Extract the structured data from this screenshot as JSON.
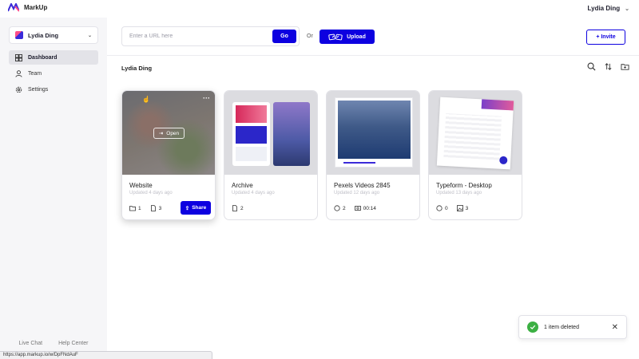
{
  "app": {
    "name": "MarkUp"
  },
  "header": {
    "user_name": "Lydia Ding"
  },
  "sidebar": {
    "workspace": "Lydia Ding",
    "items": [
      {
        "label": "Dashboard",
        "icon": "dashboard-icon",
        "active": true
      },
      {
        "label": "Team",
        "icon": "user-icon",
        "active": false
      },
      {
        "label": "Settings",
        "icon": "gear-icon",
        "active": false
      }
    ],
    "footer": {
      "live_chat": "Live Chat",
      "help_center": "Help Center"
    }
  },
  "url_bar": {
    "placeholder": "Enter a URL here",
    "value": "",
    "go_label": "Go",
    "or_text": "Or",
    "upload_label": "Upload"
  },
  "invite_label": "+ Invite",
  "main": {
    "folder_title": "Lydia Ding"
  },
  "cards": [
    {
      "title": "Website",
      "subtitle": "Updated 4 days ago",
      "folders": "1",
      "files": "3",
      "open_label": "Open",
      "share_label": "Share"
    },
    {
      "title": "Archive",
      "subtitle": "Updated 4 days ago",
      "files": "2"
    },
    {
      "title": "Pexels Videos 2845",
      "subtitle": "Updated 12 days ago",
      "comments": "2",
      "duration": "00:14"
    },
    {
      "title": "Typeform - Desktop",
      "subtitle": "Updated 13 days ago",
      "comments": "0",
      "images": "3"
    }
  ],
  "toast": {
    "message": "1 item deleted"
  },
  "status_url": "https://app.markup.io/w/DpFNdAuF",
  "colors": {
    "accent": "#0d00e0",
    "success": "#3cb043"
  }
}
